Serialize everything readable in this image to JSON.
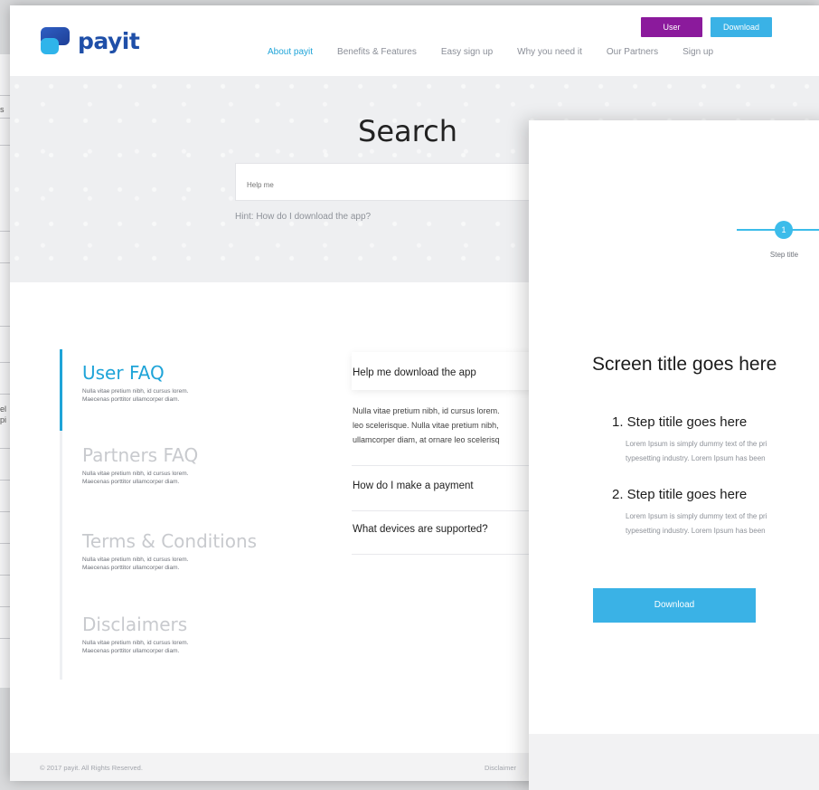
{
  "brand": {
    "name": "payit"
  },
  "top_buttons": {
    "user": "User",
    "download": "Download"
  },
  "colors": {
    "accent": "#1fa4d8",
    "user_button": "#8b1a9c",
    "download_button": "#3ab2e6",
    "brand": "#1f4fa8"
  },
  "nav": {
    "items": [
      {
        "label": "About payit",
        "active": true
      },
      {
        "label": "Benefits & Features"
      },
      {
        "label": "Easy sign up"
      },
      {
        "label": "Why you need it"
      },
      {
        "label": "Our Partners"
      },
      {
        "label": "Sign up"
      }
    ]
  },
  "search": {
    "title": "Search",
    "placeholder": "Help me",
    "hint": "Hint: How do I download the app?"
  },
  "faq": {
    "categories": [
      {
        "title": "User FAQ",
        "desc_line1": "Nulla vitae pretium nibh, id cursus lorem.",
        "desc_line2": "Maecenas porttitor ullamcorper diam."
      },
      {
        "title": "Partners FAQ",
        "desc_line1": "Nulla vitae pretium nibh, id cursus lorem.",
        "desc_line2": "Maecenas porttitor ullamcorper diam."
      },
      {
        "title": "Terms & Conditions",
        "desc_line1": "Nulla vitae pretium nibh, id cursus lorem.",
        "desc_line2": "Maecenas porttitor ullamcorper diam."
      },
      {
        "title": "Disclaimers",
        "desc_line1": "Nulla vitae pretium nibh, id cursus lorem.",
        "desc_line2": "Maecenas porttitor ullamcorper diam."
      }
    ],
    "questions": [
      {
        "q": "Help me download the app"
      },
      {
        "q": "How do I make a payment"
      },
      {
        "q": "What devices are supported?"
      }
    ],
    "answer": {
      "line1": "Nulla vitae pretium nibh, id cursus lorem.",
      "line2": "leo scelerisque. Nulla vitae pretium nibh,",
      "line3": "ullamcorper diam, at ornare leo scelerisq"
    }
  },
  "footer": {
    "copyright": "© 2017 payit. All Rights Reserved.",
    "disclaimer": "Disclaimer"
  },
  "modal": {
    "step_number": "1",
    "step_label": "Step title",
    "screen_title": "Screen title goes here",
    "steps": [
      {
        "title": "1. Step titile goes here",
        "line1": "Lorem Ipsum is simply dummy text of the pri",
        "line2": "typesetting industry. Lorem Ipsum has been"
      },
      {
        "title": "2. Step titile goes here",
        "line1": "Lorem Ipsum is simply dummy text of the pri",
        "line2": "typesetting industry. Lorem Ipsum has been"
      }
    ],
    "download_label": "Download"
  }
}
